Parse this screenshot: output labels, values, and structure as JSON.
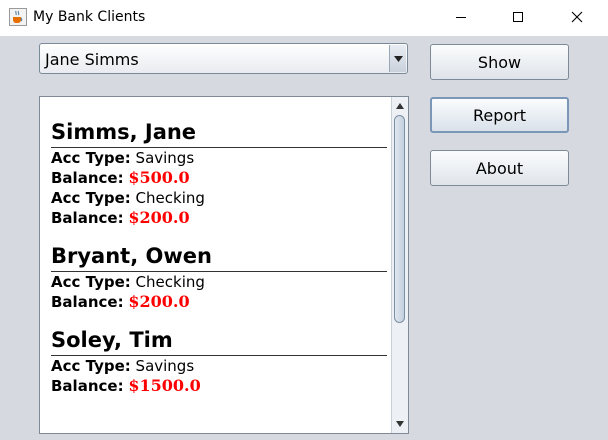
{
  "window": {
    "title": "My Bank Clients",
    "controls": [
      "minimize-icon",
      "maximize-icon",
      "close-icon"
    ]
  },
  "client_selector": {
    "selected": "Jane Simms"
  },
  "buttons": {
    "show": "Show",
    "report": "Report",
    "about": "About"
  },
  "report": {
    "acc_type_label": "Acc Type:",
    "balance_label": "Balance:",
    "clients": [
      {
        "name": "Simms, Jane",
        "accounts": [
          {
            "type": "Savings",
            "balance": "$500.0"
          },
          {
            "type": "Checking",
            "balance": "$200.0"
          }
        ]
      },
      {
        "name": "Bryant, Owen",
        "accounts": [
          {
            "type": "Checking",
            "balance": "$200.0"
          }
        ]
      },
      {
        "name": "Soley, Tim",
        "accounts": [
          {
            "type": "Savings",
            "balance": "$1500.0"
          }
        ]
      }
    ]
  },
  "colors": {
    "balance": "#ff0000",
    "client_area": "#d6d9e0"
  }
}
